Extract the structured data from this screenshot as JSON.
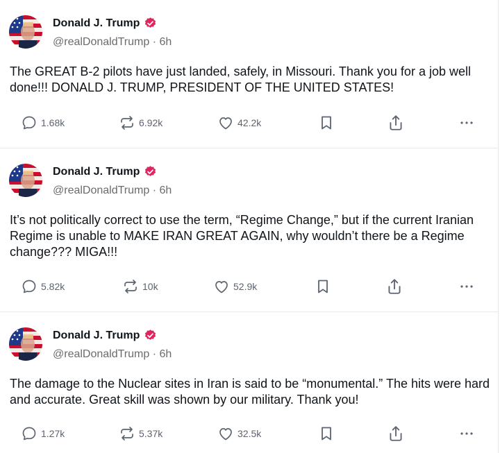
{
  "posts": [
    {
      "author": "Donald J. Trump",
      "handle": "@realDonaldTrump",
      "separator": "·",
      "time": "6h",
      "text": "The GREAT B-2 pilots have just landed, safely, in Missouri. Thank you for a job well done!!! DONALD J. TRUMP, PRESIDENT OF THE UNITED STATES!",
      "replies": "1.68k",
      "reposts": "6.92k",
      "likes": "42.2k"
    },
    {
      "author": "Donald J. Trump",
      "handle": "@realDonaldTrump",
      "separator": "·",
      "time": "6h",
      "text": "It’s not politically correct to use the term, “Regime Change,” but if the current Iranian Regime is unable to MAKE IRAN GREAT AGAIN, why wouldn’t there be a Regime change??? MIGA!!!",
      "replies": "5.82k",
      "reposts": "10k",
      "likes": "52.9k"
    },
    {
      "author": "Donald J. Trump",
      "handle": "@realDonaldTrump",
      "separator": "·",
      "time": "6h",
      "text": "The damage to the Nuclear sites in Iran is said to be “monumental.” The hits were hard and accurate. Great skill was shown by our military. Thank you!",
      "replies": "1.27k",
      "reposts": "5.37k",
      "likes": "32.5k"
    }
  ],
  "icons": {
    "reply": "reply-icon",
    "repost": "repost-icon",
    "like": "heart-icon",
    "bookmark": "bookmark-icon",
    "share": "share-icon",
    "more": "more-icon",
    "verified": "verified-badge-icon"
  },
  "colors": {
    "verified_badge": "#e0245e",
    "muted_text": "#6b6b6b",
    "icon": "#5b6470"
  }
}
